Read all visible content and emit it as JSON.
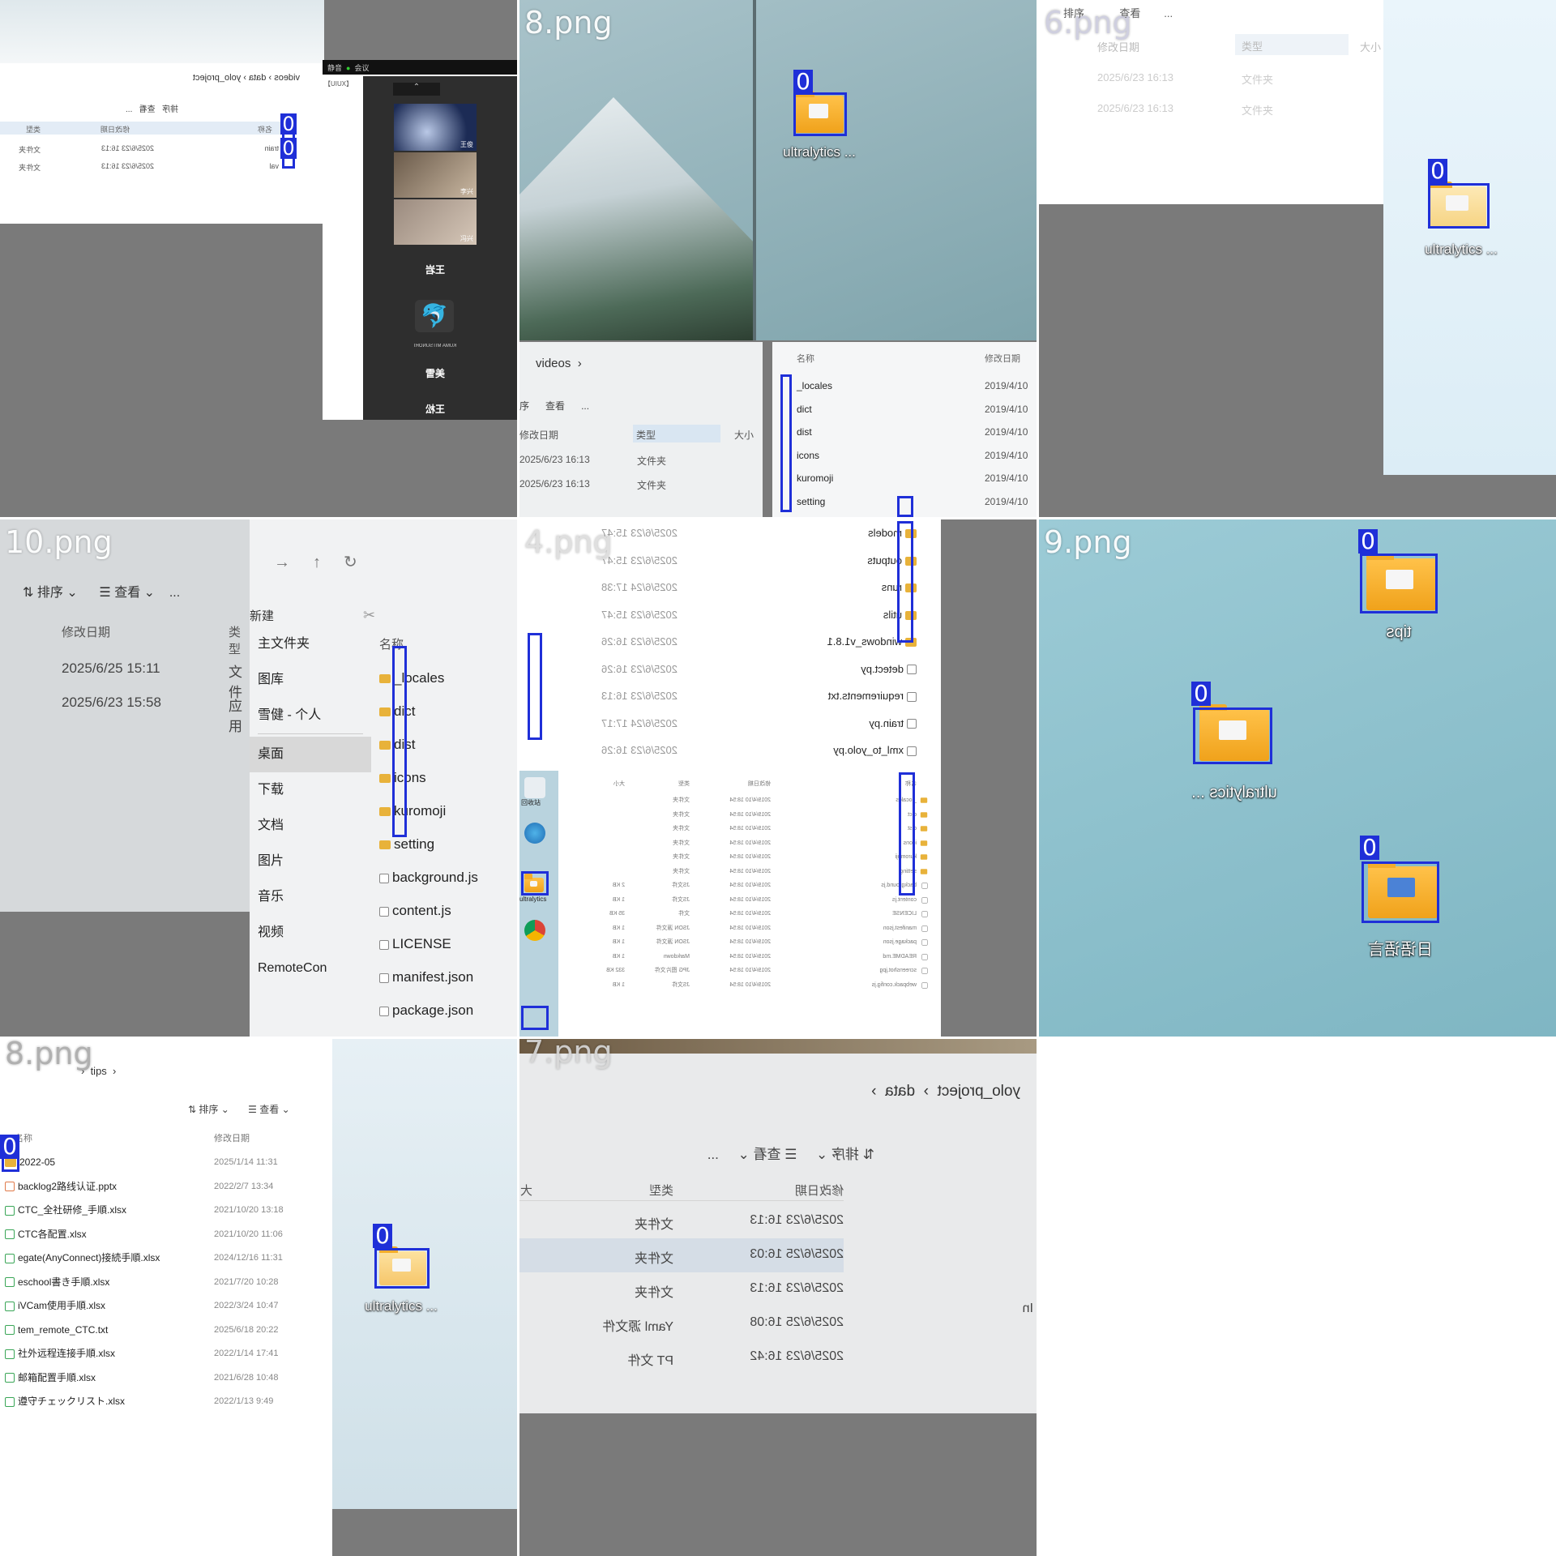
{
  "tiles": [
    {
      "label": "",
      "breadcrumb": [
        "videos",
        "data",
        "yolo_project"
      ],
      "toolbar": {
        "more": "...",
        "view": "查看",
        "sort": "排序"
      },
      "columns": [
        "类型",
        "修改日期",
        "名称"
      ],
      "rows": [
        {
          "type": "文件夹",
          "date": "2025/6/23 16:13",
          "name": "train"
        },
        {
          "type": "文件夹",
          "date": "2025/6/23 16:13",
          "name": "val"
        }
      ],
      "meeting": {
        "topbar": [
          "静音",
          "会议"
        ],
        "title": "【UIUX】",
        "participants": [
          "王俊",
          "李兴",
          "冯兴",
          "王岩",
          "KUMA MITSUNORI",
          "郑",
          "美雪",
          "王松"
        ]
      },
      "detections": [
        "0",
        "0"
      ]
    },
    {
      "label": "8.png",
      "desktop_folder": {
        "name": "ultralytics ...",
        "tag": "0"
      },
      "breadcrumb": "videos",
      "toolbar": {
        "sort": "序",
        "view": "查看",
        "more": "..."
      },
      "columns": [
        "修改日期",
        "类型",
        "大小"
      ],
      "rows": [
        {
          "date": "2025/6/23 16:13",
          "type": "文件夹"
        },
        {
          "date": "2025/6/23 16:13",
          "type": "文件夹"
        }
      ],
      "right_columns": [
        "名称",
        "修改日期"
      ],
      "right_rows": [
        {
          "name": "_locales",
          "date": "2019/4/10"
        },
        {
          "name": "dict",
          "date": "2019/4/10"
        },
        {
          "name": "dist",
          "date": "2019/4/10"
        },
        {
          "name": "icons",
          "date": "2019/4/10"
        },
        {
          "name": "kuromoji",
          "date": "2019/4/10"
        },
        {
          "name": "setting",
          "date": "2019/4/10"
        }
      ]
    },
    {
      "label": "6.png",
      "toolbar": {
        "sort": "排序",
        "view": "查看",
        "more": "..."
      },
      "columns": [
        "修改日期",
        "类型",
        "大小"
      ],
      "rows": [
        {
          "date": "2025/6/23 16:13",
          "type": "文件夹"
        },
        {
          "date": "2025/6/23 16:13",
          "type": "文件夹"
        }
      ],
      "desktop_folder": {
        "name": "ultralytics ...",
        "tag": "0"
      }
    },
    {
      "label": "10.png",
      "toolbar": {
        "sort": "排序",
        "view": "查看",
        "more": "...",
        "new": "新建"
      },
      "columns": [
        "修改日期",
        "类型"
      ],
      "rows": [
        {
          "date": "2025/6/25 15:11",
          "type": "文件"
        },
        {
          "date": "2025/6/23 15:58",
          "type": "应用"
        }
      ],
      "nav": [
        "主文件夹",
        "图库",
        "雪健 - 个人",
        "桌面",
        "下载",
        "文档",
        "图片",
        "音乐",
        "视频",
        "RemoteCon"
      ],
      "name_header": "名称",
      "files": [
        "_locales",
        "dict",
        "dist",
        "icons",
        "kuromoji",
        "setting",
        "background.js",
        "content.js",
        "LICENSE",
        "manifest.json",
        "package.json"
      ]
    },
    {
      "label": "4.png",
      "top_rows": [
        {
          "name": "models",
          "date": "2025/6/23 15:47"
        },
        {
          "name": "outputs",
          "date": "2025/6/23 15:47"
        },
        {
          "name": "runs",
          "date": "2025/6/24 17:38"
        },
        {
          "name": "utils",
          "date": "2025/6/23 15:47"
        },
        {
          "name": "windows_v1.8.1",
          "date": "2025/6/23 16:26"
        },
        {
          "name": "detect.py",
          "date": "2025/6/23 16:26"
        },
        {
          "name": "requirements.txt",
          "date": "2025/6/23 16:13"
        },
        {
          "name": "train.py",
          "date": "2025/6/24 17:17"
        },
        {
          "name": "xml_to_yolo.py",
          "date": "2025/6/23 16:26"
        }
      ],
      "bottom_rows": [
        {
          "name": "_locales",
          "date": "2019/4/10 18:54",
          "type": "文件夹",
          "size": ""
        },
        {
          "name": "dict",
          "date": "2019/4/10 18:54",
          "type": "文件夹",
          "size": ""
        },
        {
          "name": "dist",
          "date": "2019/4/10 18:54",
          "type": "文件夹",
          "size": ""
        },
        {
          "name": "icons",
          "date": "2019/4/10 18:54",
          "type": "文件夹",
          "size": ""
        },
        {
          "name": "kuromoji",
          "date": "2019/4/10 18:54",
          "type": "文件夹",
          "size": ""
        },
        {
          "name": "setting",
          "date": "2019/4/10 18:54",
          "type": "文件夹",
          "size": ""
        },
        {
          "name": "background.js",
          "date": "2019/4/10 18:54",
          "type": "JS文件",
          "size": "2 KB"
        },
        {
          "name": "content.js",
          "date": "2019/4/10 18:54",
          "type": "JS文件",
          "size": "1 KB"
        },
        {
          "name": "LICENSE",
          "date": "2019/4/10 18:54",
          "type": "文件",
          "size": "35 KB"
        },
        {
          "name": "manifest.json",
          "date": "2019/4/10 18:54",
          "type": "JSON 源文件",
          "size": "1 KB"
        },
        {
          "name": "package.json",
          "date": "2019/4/10 18:54",
          "type": "JSON 源文件",
          "size": "1 KB"
        },
        {
          "name": "README.md",
          "date": "2019/4/10 18:54",
          "type": "Markdown",
          "size": "1 KB"
        },
        {
          "name": "screenshot.jpg",
          "date": "2019/4/10 18:54",
          "type": "JPG 图片文件",
          "size": "332 KB"
        },
        {
          "name": "webpack.config.js",
          "date": "2019/4/10 18:54",
          "type": "JS文件",
          "size": "1 KB"
        }
      ],
      "bottom_columns": [
        "名称",
        "修改日期",
        "类型",
        "大小"
      ],
      "desktop_labels": [
        "回收站",
        "Microsoft Edge",
        "ultralytics",
        "Google Chrome"
      ]
    },
    {
      "label": "9.png",
      "folders": [
        {
          "name": "tips",
          "tag": "0"
        },
        {
          "name": "ultralytics ...",
          "tag": "0"
        },
        {
          "name": "日语语言",
          "tag": "0"
        }
      ]
    },
    {
      "label": "8.png",
      "breadcrumb": "tips",
      "toolbar": {
        "sort": "排序",
        "view": "查看"
      },
      "columns": [
        "名称",
        "修改日期"
      ],
      "rows": [
        {
          "name": "2022-05",
          "date": "2025/1/14 11:31"
        },
        {
          "name": "backlog2路线认证.pptx",
          "date": "2022/2/7 13:34"
        },
        {
          "name": "CTC_全社研修_手順.xlsx",
          "date": "2021/10/20 13:18"
        },
        {
          "name": "CTC各配置.xlsx",
          "date": "2021/10/20 11:06"
        },
        {
          "name": "egate(AnyConnect)接続手順.xlsx",
          "date": "2024/12/16 11:31"
        },
        {
          "name": "eschool書き手順.xlsx",
          "date": "2021/7/20 10:28"
        },
        {
          "name": "iVCam使用手順.xlsx",
          "date": "2022/3/24 10:47"
        },
        {
          "name": "tem_remote_CTC.txt",
          "date": "2025/6/18 20:22"
        },
        {
          "name": "社外远程连接手順.xlsx",
          "date": "2022/1/14 17:41"
        },
        {
          "name": "邮箱配置手順.xlsx",
          "date": "2021/6/28 10:48"
        },
        {
          "name": "遵守チェックリスト.xlsx",
          "date": "2022/1/13 9:49"
        }
      ],
      "desktop_folder": {
        "name": "ultralytics ...",
        "tag": "0"
      }
    },
    {
      "label": "7.png",
      "breadcrumb": [
        "yolo_project",
        "data"
      ],
      "toolbar": {
        "sort": "排序",
        "view": "查看",
        "more": "..."
      },
      "columns": [
        "修改日期",
        "类型",
        "大"
      ],
      "rows": [
        {
          "date": "2025/6/23 16:13",
          "type": "文件夹"
        },
        {
          "date": "2025/6/25 16:03",
          "type": "文件夹"
        },
        {
          "date": "2025/6/23 16:13",
          "type": "文件夹"
        },
        {
          "date": "2025/6/25 16:08",
          "type": "Yaml 源文件"
        },
        {
          "date": "2025/6/23 16:42",
          "type": "PT 文件"
        }
      ],
      "side_text": "In"
    }
  ],
  "colors": {
    "detection": "#1f2fd8",
    "folder": "#f3ad2a",
    "desktop_sky": "#8fbfca"
  },
  "detection_tag": "0"
}
